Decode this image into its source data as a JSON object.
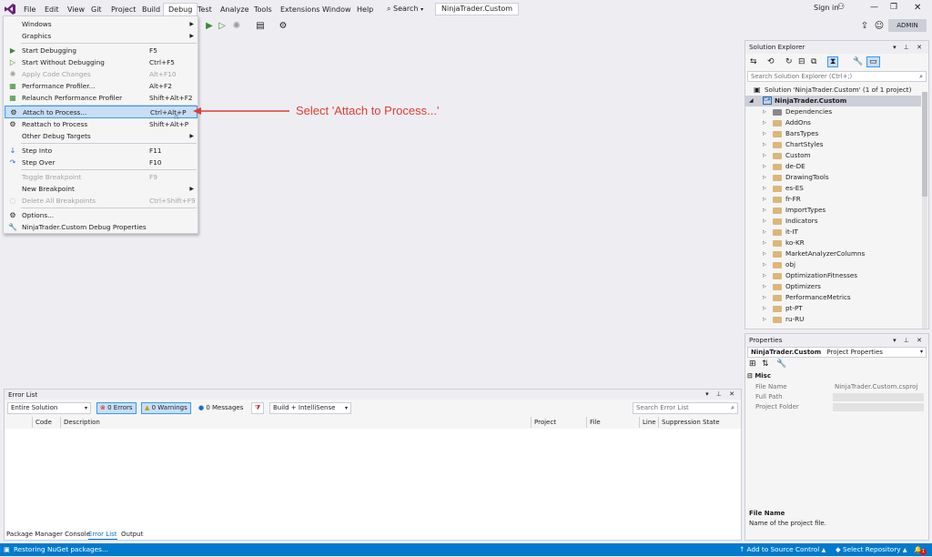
{
  "menu": {
    "items": [
      "File",
      "Edit",
      "View",
      "Git",
      "Project",
      "Build",
      "Debug",
      "Test",
      "Analyze",
      "Tools",
      "Extensions",
      "Window",
      "Help"
    ],
    "search_label": "Search",
    "solution_name": "NinjaTrader.Custom",
    "sign_in": "Sign in",
    "admin_badge": "ADMIN"
  },
  "debug_menu": {
    "items": [
      {
        "label": "Windows",
        "shortcut": "",
        "submenu": true
      },
      {
        "label": "Graphics",
        "shortcut": "",
        "submenu": true
      },
      {
        "label": "Start Debugging",
        "shortcut": "F5"
      },
      {
        "label": "Start Without Debugging",
        "shortcut": "Ctrl+F5"
      },
      {
        "label": "Apply Code Changes",
        "shortcut": "Alt+F10"
      },
      {
        "label": "Performance Profiler...",
        "shortcut": "Alt+F2"
      },
      {
        "label": "Relaunch Performance Profiler",
        "shortcut": "Shift+Alt+F2"
      },
      {
        "label": "Attach to Process...",
        "shortcut": "Ctrl+Alt+P"
      },
      {
        "label": "Reattach to Process",
        "shortcut": "Shift+Alt+P"
      },
      {
        "label": "Other Debug Targets",
        "shortcut": "",
        "submenu": true
      },
      {
        "label": "Step Into",
        "shortcut": "F11"
      },
      {
        "label": "Step Over",
        "shortcut": "F10"
      },
      {
        "label": "Toggle Breakpoint",
        "shortcut": "F9"
      },
      {
        "label": "New Breakpoint",
        "shortcut": "",
        "submenu": true
      },
      {
        "label": "Delete All Breakpoints",
        "shortcut": "Ctrl+Shift+F9"
      },
      {
        "label": "Options...",
        "shortcut": ""
      },
      {
        "label": "NinjaTrader.Custom Debug Properties",
        "shortcut": ""
      }
    ]
  },
  "annotation": {
    "text": "Select 'Attach to Process...'",
    "color": "#e03c31"
  },
  "solution_explorer": {
    "title": "Solution Explorer",
    "search_placeholder": "Search Solution Explorer (Ctrl+;)",
    "solution_label": "Solution 'NinjaTrader.Custom' (1 of 1 project)",
    "project_label": "NinjaTrader.Custom",
    "nodes": [
      "Dependencies",
      "AddOns",
      "BarsTypes",
      "ChartStyles",
      "Custom",
      "de-DE",
      "DrawingTools",
      "es-ES",
      "fr-FR",
      "ImportTypes",
      "Indicators",
      "it-IT",
      "ko-KR",
      "MarketAnalyzerColumns",
      "obj",
      "OptimizationFitnesses",
      "Optimizers",
      "PerformanceMetrics",
      "pt-PT",
      "ru-RU"
    ]
  },
  "properties": {
    "title": "Properties",
    "object_name": "NinjaTrader.Custom",
    "object_type": "Project Properties",
    "category": "Misc",
    "rows": [
      {
        "key": "File Name",
        "value": "NinjaTrader.Custom.csproj"
      },
      {
        "key": "Full Path",
        "value": ""
      },
      {
        "key": "Project Folder",
        "value": ""
      }
    ],
    "desc_title": "File Name",
    "desc_text": "Name of the project file."
  },
  "error_list": {
    "title": "Error List",
    "scope": "Entire Solution",
    "errors": "0 Errors",
    "warnings": "0 Warnings",
    "messages": "0 Messages",
    "build_filter": "Build + IntelliSense",
    "search_placeholder": "Search Error List",
    "columns": [
      "Code",
      "Description",
      "Project",
      "File",
      "Line",
      "Suppression State"
    ]
  },
  "bottom_tabs": [
    "Package Manager Console",
    "Error List",
    "Output"
  ],
  "status": {
    "left": "Restoring NuGet packages...",
    "source_control": "Add to Source Control",
    "repository": "Select Repository",
    "notifications": "1"
  }
}
